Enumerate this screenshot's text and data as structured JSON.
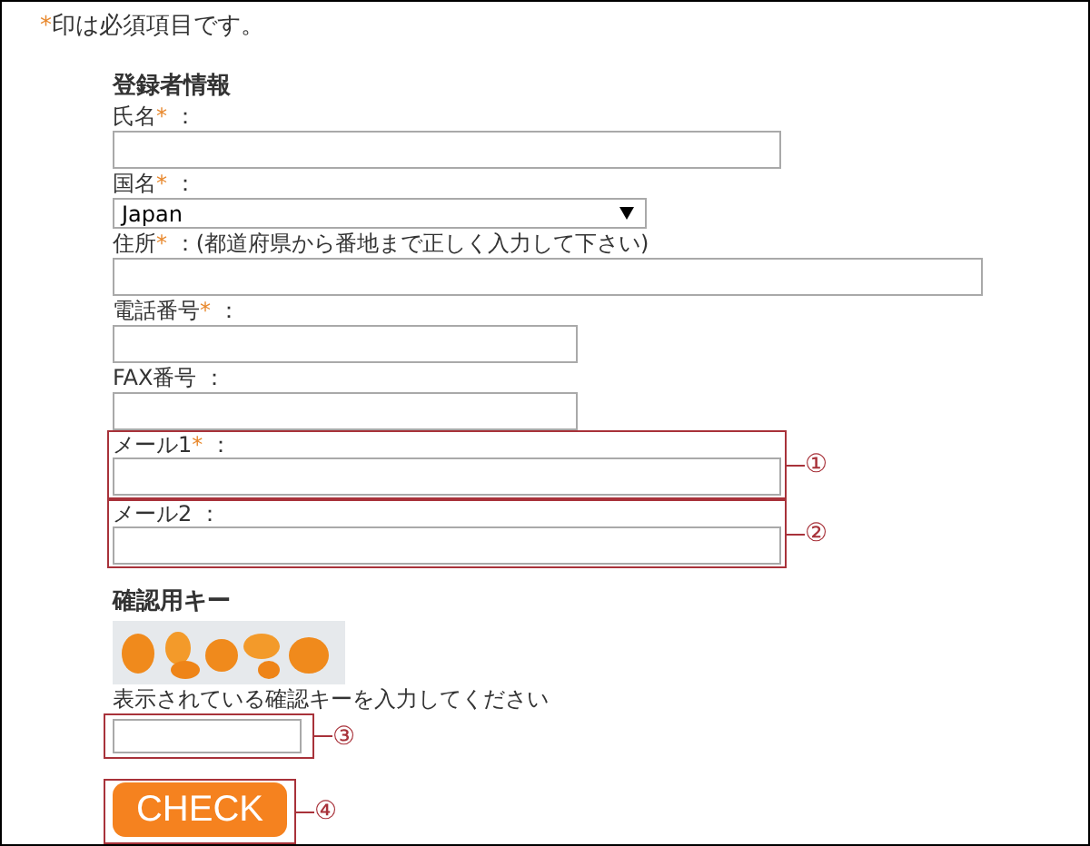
{
  "required_mark": "*",
  "required_note": "印は必須項目です。",
  "section_title": "登録者情報",
  "fields": [
    {
      "kind": "text",
      "label": "氏名",
      "required": true,
      "suffix": "："
    },
    {
      "kind": "select",
      "label": "国名",
      "required": true,
      "suffix": "：",
      "value": "Japan"
    },
    {
      "kind": "text",
      "label": "住所",
      "required": true,
      "suffix": "：(都道府県から番地まで正しく入力して下さい)"
    },
    {
      "kind": "text",
      "label": "電話番号",
      "required": true,
      "suffix": "："
    },
    {
      "kind": "text",
      "label": "FAX番号",
      "required": false,
      "suffix": "："
    },
    {
      "kind": "text",
      "label": "メール1",
      "required": true,
      "suffix": "：",
      "callout": "①"
    },
    {
      "kind": "text",
      "label": "メール2",
      "required": false,
      "suffix": "：",
      "callout": "②"
    }
  ],
  "captcha": {
    "title": "確認用キー",
    "instruction": "表示されている確認キーを入力してください",
    "callout": "③"
  },
  "submit": {
    "label": "CHECK",
    "callout": "④"
  }
}
